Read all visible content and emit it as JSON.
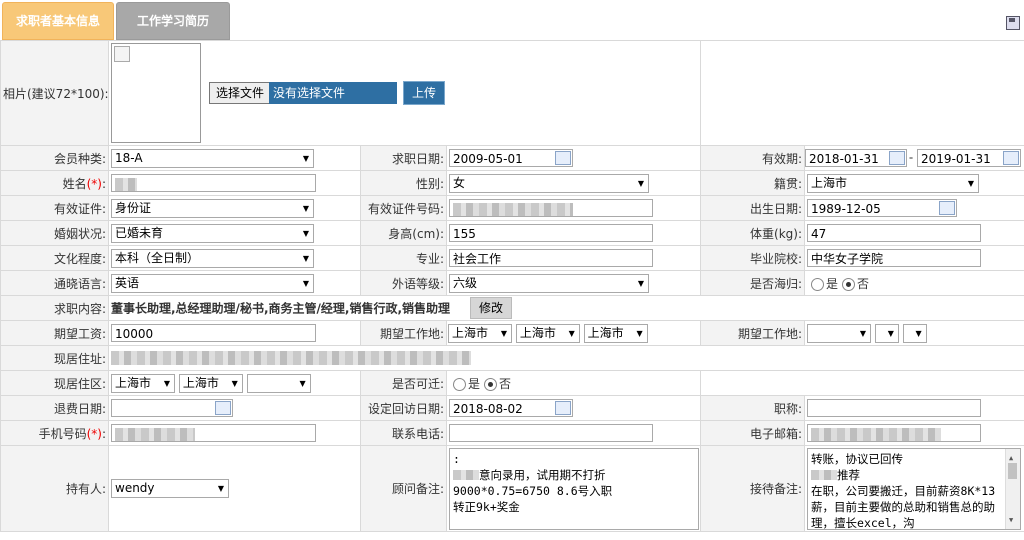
{
  "tabs": {
    "basic_info": "求职者基本信息",
    "work_history": "工作学习简历"
  },
  "photo": {
    "label": "相片(建议72*100):",
    "choose_file": "选择文件",
    "no_file": "没有选择文件",
    "upload": "上传"
  },
  "row1": {
    "member_type_label": "会员种类:",
    "member_type": "18-A",
    "apply_date_label": "求职日期:",
    "apply_date": "2009-05-01",
    "valid_label": "有效期:",
    "valid_from": "2018-01-31",
    "valid_sep": "-",
    "valid_to": "2019-01-31"
  },
  "row2": {
    "name_label": "姓名",
    "req": "(*)",
    "colon": ":",
    "gender_label": "性别:",
    "gender": "女",
    "origin_label": "籍贯:",
    "origin": "上海市"
  },
  "row3": {
    "id_type_label": "有效证件:",
    "id_type": "身份证",
    "id_no_label": "有效证件号码:",
    "birth_label": "出生日期:",
    "birth": "1989-12-05"
  },
  "row4": {
    "marital_label": "婚姻状况:",
    "marital": "已婚未育",
    "height_label": "身高(cm):",
    "height": "155",
    "weight_label": "体重(kg):",
    "weight": "47"
  },
  "row5": {
    "edu_label": "文化程度:",
    "edu": "本科（全日制）",
    "major_label": "专业:",
    "major": "社会工作",
    "school_label": "毕业院校:",
    "school": "中华女子学院"
  },
  "row6": {
    "lang_label": "通晓语言:",
    "lang": "英语",
    "lang_level_label": "外语等级:",
    "lang_level": "六级",
    "returnee_label": "是否海归:",
    "yes": "是",
    "no": "否"
  },
  "row7": {
    "job_label": "求职内容:",
    "job": "董事长助理,总经理助理/秘书,商务主管/经理,销售行政,销售助理",
    "edit": "修改"
  },
  "row8": {
    "salary_label": "期望工资:",
    "salary": "10000",
    "loc_label": "期望工作地:",
    "loc1": "上海市",
    "loc2": "上海市",
    "loc3": "上海市",
    "loc2_label": "期望工作地:"
  },
  "row9": {
    "addr_label": "现居住址:"
  },
  "row10": {
    "area_label": "现居住区:",
    "area1": "上海市",
    "area2": "上海市",
    "relocate_label": "是否可迁:",
    "yes": "是",
    "no": "否"
  },
  "row11": {
    "refund_label": "退费日期:",
    "visit_label": "设定回访日期:",
    "visit": "2018-08-02",
    "title_label": "职称:"
  },
  "row12": {
    "mobile_label": "手机号码",
    "req": "(*)",
    "colon": ":",
    "phone_label": "联系电话:",
    "email_label": "电子邮箱:"
  },
  "row13": {
    "holder_label": "持有人:",
    "holder": "wendy",
    "advisor_label": "顾问备注:",
    "advisor_note_l1": ":",
    "advisor_note_l2": "意向录用，试用期不打折",
    "advisor_note_l3": "9000*0.75=6750 8.6号入职",
    "advisor_note_l4": "转正9k+奖金",
    "receiver_label": "接待备注:",
    "receiver_note_l1": "转账，协议已回传",
    "receiver_note_l2": "推荐",
    "receiver_note_l3": "在职，公司要搬迁，目前薪资8K*13薪，目前主要做的总助和销售总的助理，擅长excel，沟"
  },
  "icons": {
    "save": "save-icon",
    "calendar": "calendar-icon",
    "dropdown": "chevron-down-icon"
  }
}
